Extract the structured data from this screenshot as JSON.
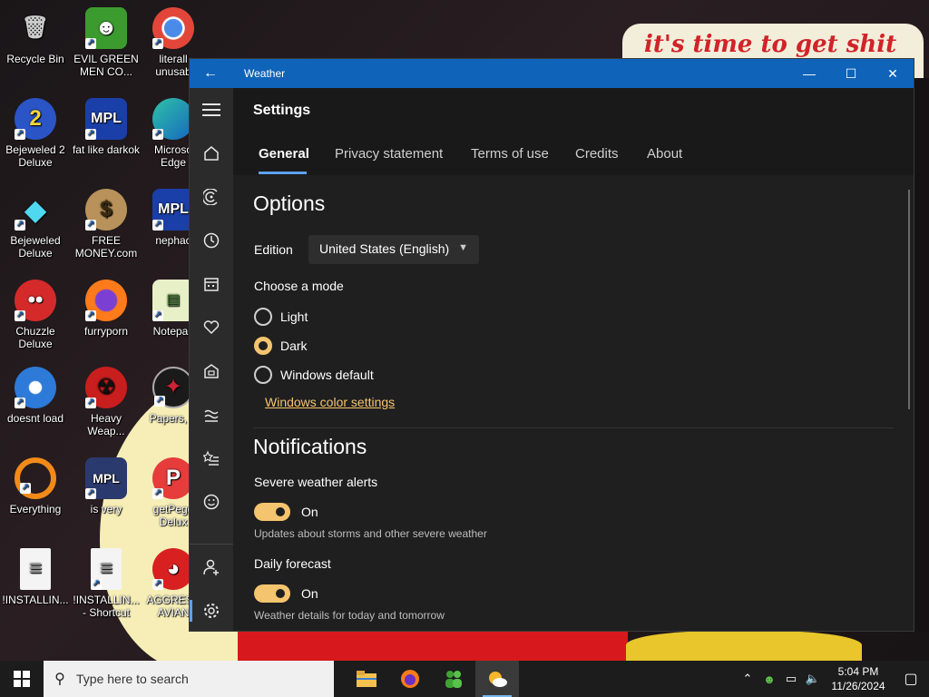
{
  "desktop": {
    "banner_text": "it's time to get shit",
    "icons": [
      {
        "label": "Recycle Bin",
        "icon": "recycle-bin-icon"
      },
      {
        "label": "EVIL GREEN MEN CO...",
        "icon": "green-men-icon"
      },
      {
        "label": "literall unusab",
        "icon": "chrome-icon"
      },
      {
        "label": "Bejeweled 2 Deluxe",
        "icon": "bejeweled2-icon"
      },
      {
        "label": "fat like darkok",
        "icon": "mpl-icon"
      },
      {
        "label": "Microso Edge",
        "icon": "edge-icon"
      },
      {
        "label": "Bejeweled Deluxe",
        "icon": "bejeweled-icon"
      },
      {
        "label": "FREE MONEY.com",
        "icon": "money-bag-icon"
      },
      {
        "label": "nephac",
        "icon": "mpl-icon"
      },
      {
        "label": "Chuzzle Deluxe",
        "icon": "chuzzle-icon"
      },
      {
        "label": "furryporn",
        "icon": "firefox-icon"
      },
      {
        "label": "Notepac",
        "icon": "notepad-icon"
      },
      {
        "label": "doesnt load",
        "icon": "thunderbird-icon"
      },
      {
        "label": "Heavy Weap...",
        "icon": "radiation-icon"
      },
      {
        "label": "Papers, P",
        "icon": "papers-icon"
      },
      {
        "label": "Everything",
        "icon": "everything-icon"
      },
      {
        "label": "is very",
        "icon": "mpl-shield-icon"
      },
      {
        "label": "getPegg Delux",
        "icon": "peggle-icon"
      },
      {
        "label": "!INSTALLIN...",
        "icon": "document-icon"
      },
      {
        "label": "!INSTALLIN... - Shortcut",
        "icon": "document-icon"
      },
      {
        "label": "AGGRESS AVIAN",
        "icon": "angry-bird-icon"
      }
    ]
  },
  "window": {
    "title": "Weather",
    "page_title": "Settings",
    "tabs": [
      "General",
      "Privacy statement",
      "Terms of use",
      "Credits",
      "About"
    ],
    "options_heading": "Options",
    "edition_label": "Edition",
    "edition_value": "United States (English)",
    "mode_label": "Choose a mode",
    "modes": [
      "Light",
      "Dark",
      "Windows default"
    ],
    "selected_mode": "Dark",
    "color_link": "Windows color settings",
    "notifications_heading": "Notifications",
    "severe_label": "Severe weather alerts",
    "severe_state": "On",
    "severe_desc": "Updates about storms and other severe weather",
    "daily_label": "Daily forecast",
    "daily_state": "On",
    "daily_desc": "Weather details for today and tomorrow"
  },
  "taskbar": {
    "search_placeholder": "Type here to search",
    "time": "5:04 PM",
    "date": "11/26/2024"
  },
  "colors": {
    "accent": "#f4c46f",
    "titlebar": "#0f63b8",
    "tab_underline": "#5ea0ef"
  }
}
